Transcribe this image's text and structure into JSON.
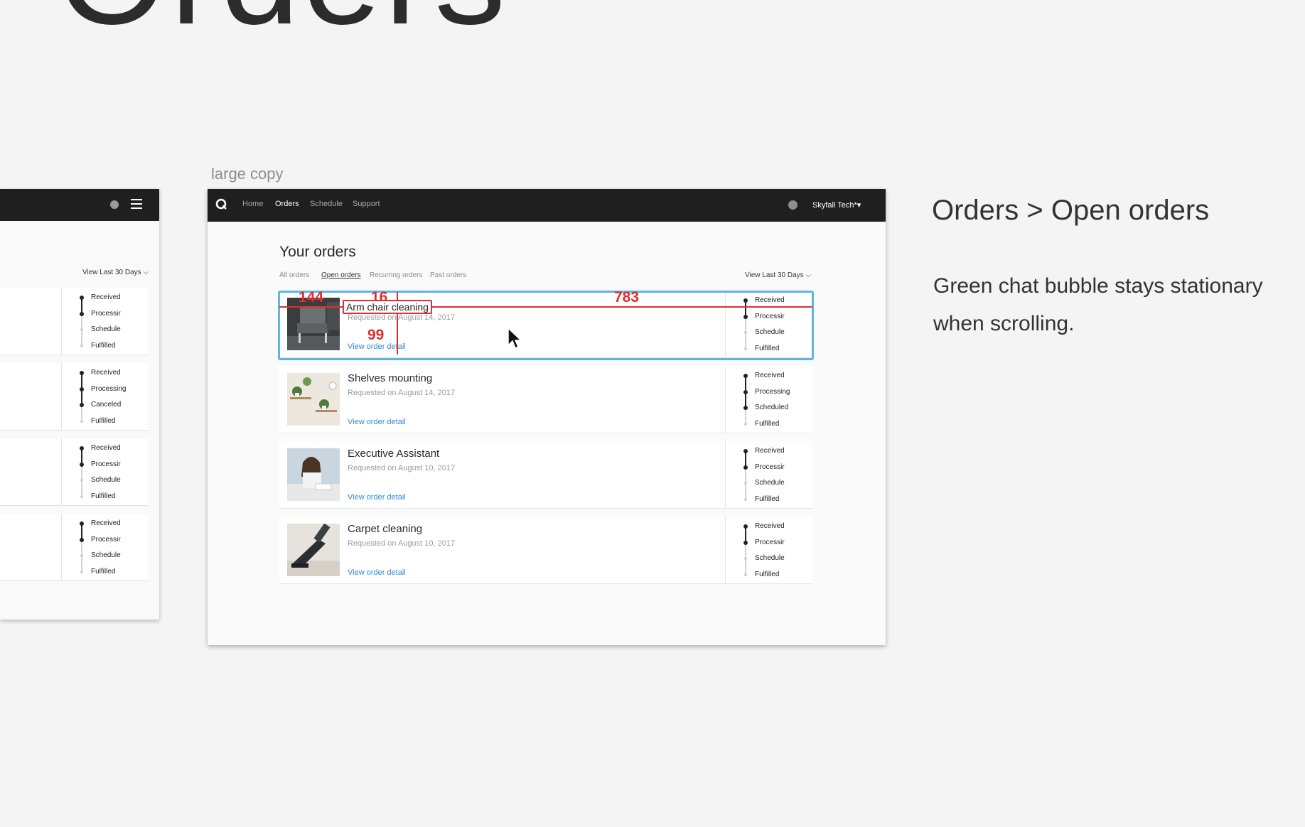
{
  "page": {
    "big_title": "Orders",
    "frame_label": "large copy"
  },
  "notes": {
    "title": "Orders > Open orders",
    "description": "Green chat bubble stays stationary when scrolling."
  },
  "left_frame": {
    "range_label": "View Last 30 Days",
    "cards": [
      {
        "steps": [
          {
            "label": "Received",
            "done": true
          },
          {
            "label": "Processir",
            "done": true
          },
          {
            "label": "Schedule",
            "done": false
          },
          {
            "label": "Fulfilled",
            "done": false
          }
        ]
      },
      {
        "steps": [
          {
            "label": "Received",
            "done": true
          },
          {
            "label": "Processing",
            "done": true
          },
          {
            "label": "Canceled",
            "done": true
          },
          {
            "label": "Fulfilled",
            "done": false
          }
        ]
      },
      {
        "steps": [
          {
            "label": "Received",
            "done": true
          },
          {
            "label": "Processir",
            "done": true
          },
          {
            "label": "Schedule",
            "done": false
          },
          {
            "label": "Fulfilled",
            "done": false
          }
        ]
      },
      {
        "steps": [
          {
            "label": "Received",
            "done": true
          },
          {
            "label": "Processir",
            "done": true
          },
          {
            "label": "Schedule",
            "done": false
          },
          {
            "label": "Fulfilled",
            "done": false
          }
        ]
      }
    ]
  },
  "app": {
    "nav": {
      "links": [
        {
          "label": "Home",
          "active": false
        },
        {
          "label": "Orders",
          "active": true
        },
        {
          "label": "Schedule",
          "active": false
        },
        {
          "label": "Support",
          "active": false
        }
      ],
      "account": "Skyfall Tech*▾"
    },
    "title": "Your orders",
    "tabs": [
      {
        "label": "All orders",
        "active": false
      },
      {
        "label": "Open orders",
        "active": true
      },
      {
        "label": "Recurring orders",
        "active": false
      },
      {
        "label": "Past orders",
        "active": false
      }
    ],
    "range_label": "View Last 30 Days",
    "link_label": "View order detail",
    "orders": [
      {
        "name": "Arm chair cleaning",
        "date": "Requested on August 14, 2017",
        "thumb": "armchair",
        "selected": true,
        "steps": [
          {
            "label": "Received",
            "done": true
          },
          {
            "label": "Processir",
            "done": true
          },
          {
            "label": "Schedule",
            "done": false
          },
          {
            "label": "Fulfilled",
            "done": false
          }
        ]
      },
      {
        "name": "Shelves mounting",
        "date": "Requested on August 14, 2017",
        "thumb": "shelves",
        "selected": false,
        "steps": [
          {
            "label": "Received",
            "done": true
          },
          {
            "label": "Processing",
            "done": true
          },
          {
            "label": "Scheduled",
            "done": true
          },
          {
            "label": "Fulfilled",
            "done": false
          }
        ]
      },
      {
        "name": "Executive Assistant",
        "date": "Requested on August 10, 2017",
        "thumb": "assistant",
        "selected": false,
        "steps": [
          {
            "label": "Received",
            "done": true
          },
          {
            "label": "Processir",
            "done": true
          },
          {
            "label": "Schedule",
            "done": false
          },
          {
            "label": "Fulfilled",
            "done": false
          }
        ]
      },
      {
        "name": "Carpet cleaning",
        "date": "Requested on August 10, 2017",
        "thumb": "vacuum",
        "selected": false,
        "steps": [
          {
            "label": "Received",
            "done": true
          },
          {
            "label": "Processir",
            "done": true
          },
          {
            "label": "Schedule",
            "done": false
          },
          {
            "label": "Fulfilled",
            "done": false
          }
        ]
      }
    ]
  },
  "annotations": {
    "measure_left": "144",
    "measure_top": "16",
    "measure_right": "783",
    "measure_bottom": "99",
    "selection_label": "Arm chair cleaning"
  },
  "colors": {
    "selection": "#5fb3e6",
    "annotation": "#e02f2f",
    "link": "#2a8ad4",
    "navbar": "#1f1f1f"
  }
}
